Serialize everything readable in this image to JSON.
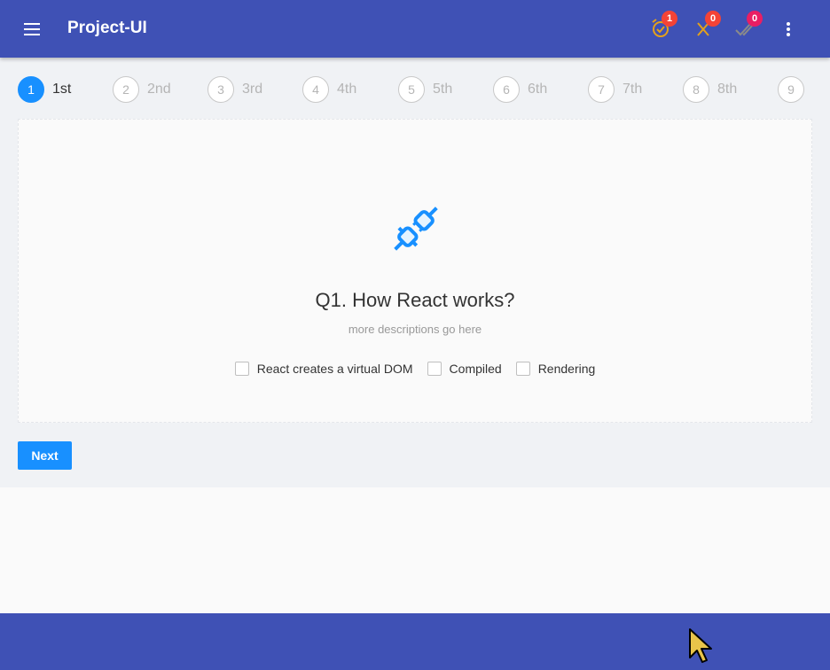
{
  "app": {
    "title": "Project-UI"
  },
  "status": {
    "pending": {
      "icon": "alarm-check-icon",
      "count": "1",
      "color": "#e4a11b",
      "badge_color": "#f44336"
    },
    "wrong": {
      "icon": "close-icon",
      "count": "0",
      "color": "#e4a11b",
      "badge_color": "#f44336"
    },
    "correct": {
      "icon": "double-check-icon",
      "count": "0",
      "color": "#8a8a8a",
      "badge_color": "#e91e63"
    }
  },
  "steps": [
    {
      "num": "1",
      "label": "1st",
      "active": true
    },
    {
      "num": "2",
      "label": "2nd",
      "active": false
    },
    {
      "num": "3",
      "label": "3rd",
      "active": false
    },
    {
      "num": "4",
      "label": "4th",
      "active": false
    },
    {
      "num": "5",
      "label": "5th",
      "active": false
    },
    {
      "num": "6",
      "label": "6th",
      "active": false
    },
    {
      "num": "7",
      "label": "7th",
      "active": false
    },
    {
      "num": "8",
      "label": "8th",
      "active": false
    },
    {
      "num": "9",
      "label": "",
      "active": false
    }
  ],
  "question": {
    "icon": "plug-icon",
    "title": "Q1. How React works?",
    "description": "more descriptions go here",
    "options": [
      {
        "label": "React creates a virtual DOM",
        "checked": false
      },
      {
        "label": "Compiled",
        "checked": false
      },
      {
        "label": "Rendering",
        "checked": false
      }
    ]
  },
  "actions": {
    "next_label": "Next"
  },
  "colors": {
    "primary": "#3f51b5",
    "accent": "#1890ff"
  }
}
